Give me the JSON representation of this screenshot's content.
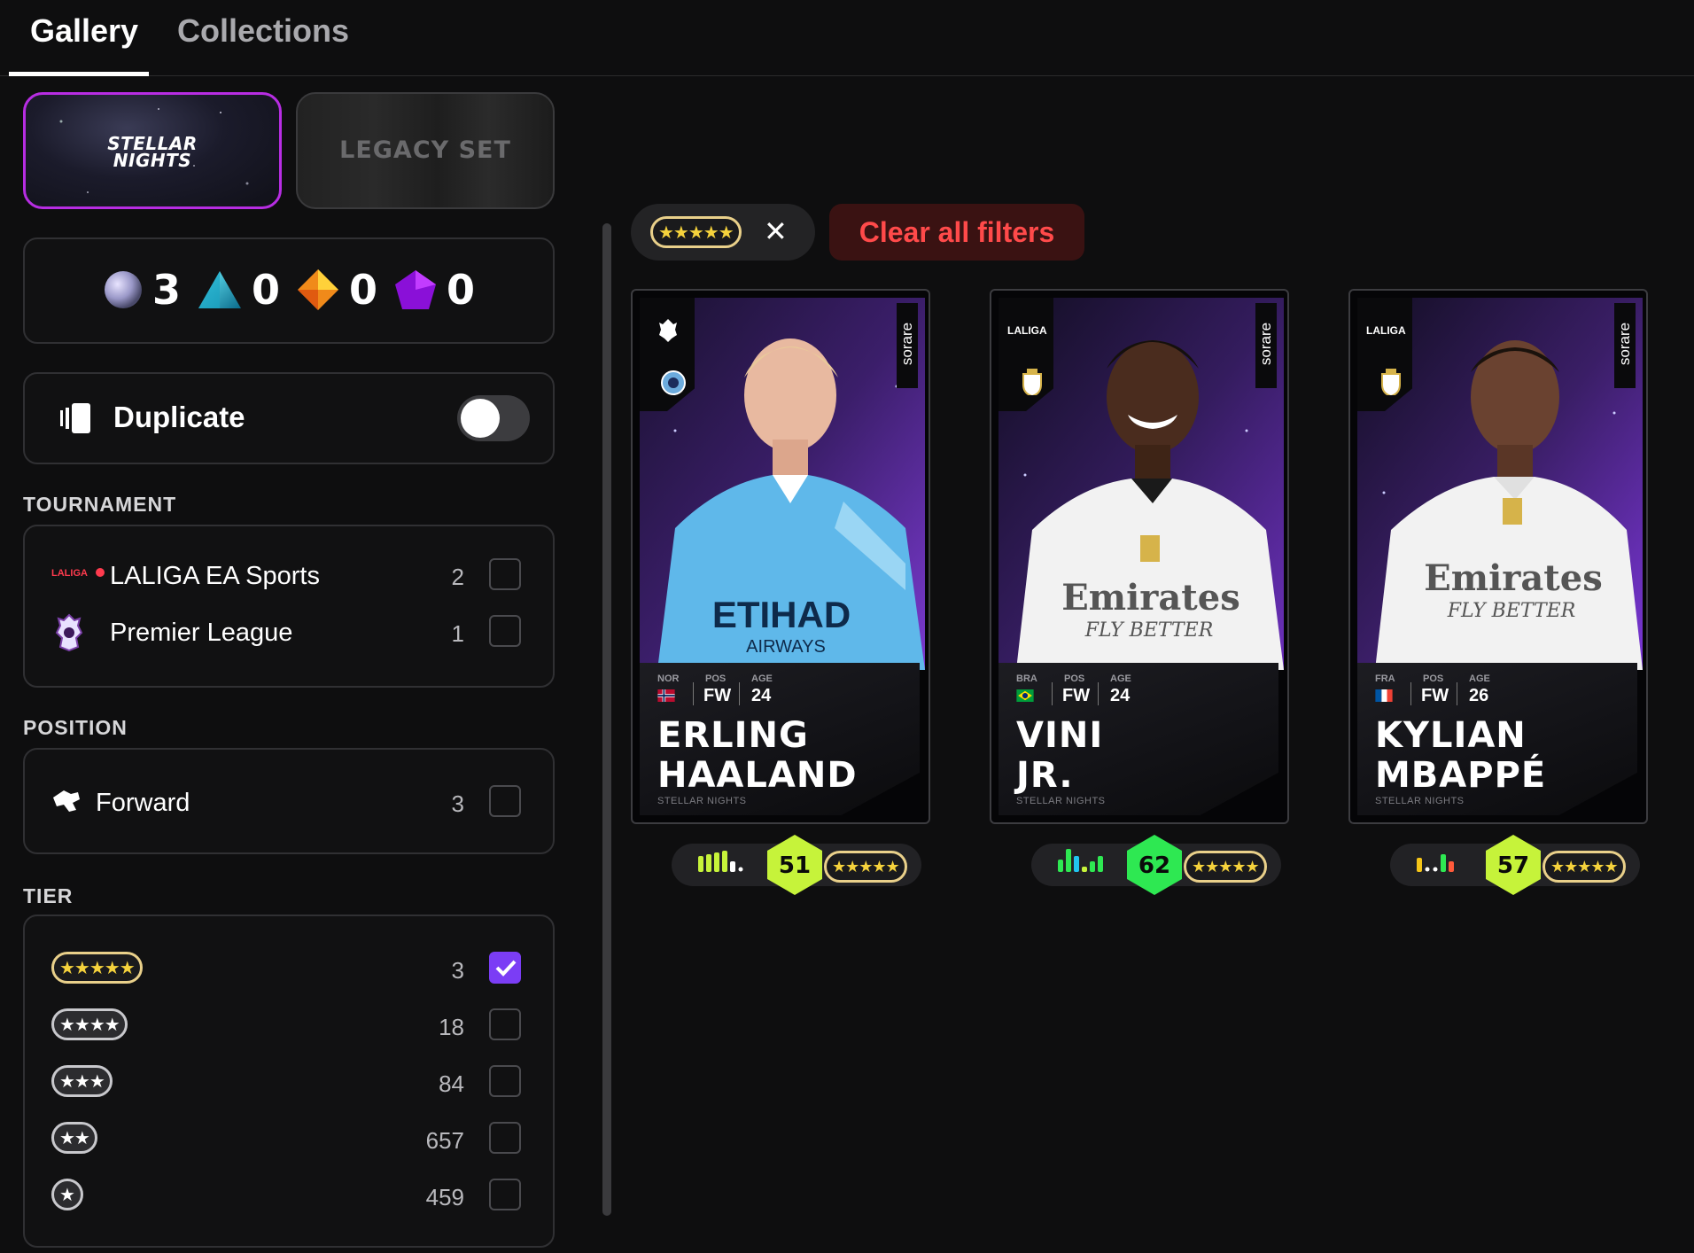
{
  "tabs": [
    {
      "label": "Gallery"
    },
    {
      "label": "Collections"
    }
  ],
  "sets": {
    "stellar_line1": "STELLAR",
    "stellar_line2": "NIGHTS",
    "legacy": "LEGACY SET"
  },
  "rarity_counts": [
    {
      "icon": "orb-icon",
      "count": "3"
    },
    {
      "icon": "triangle-gem-icon",
      "count": "0"
    },
    {
      "icon": "diamond-gem-icon",
      "count": "0"
    },
    {
      "icon": "pentagon-gem-icon",
      "count": "0"
    }
  ],
  "duplicate": {
    "label": "Duplicate",
    "enabled": false
  },
  "tournament": {
    "title": "TOURNAMENT",
    "items": [
      {
        "logo": "LALIGA",
        "label": "LALIGA EA Sports",
        "count": "2",
        "checked": false
      },
      {
        "label": "Premier League",
        "count": "1",
        "checked": false
      }
    ]
  },
  "position": {
    "title": "POSITION",
    "items": [
      {
        "label": "Forward",
        "count": "3",
        "checked": false
      }
    ]
  },
  "tier": {
    "title": "TIER",
    "items": [
      {
        "stars": 5,
        "count": "3",
        "checked": true
      },
      {
        "stars": 4,
        "count": "18",
        "checked": false
      },
      {
        "stars": 3,
        "count": "84",
        "checked": false
      },
      {
        "stars": 2,
        "count": "657",
        "checked": false
      },
      {
        "stars": 1,
        "count": "459",
        "checked": false
      }
    ]
  },
  "active_filter": {
    "stars": 5,
    "remove": "✕"
  },
  "clear_filters": "Clear all filters",
  "cards": [
    {
      "brand": "sorare",
      "league": "",
      "nat": "NOR",
      "pos_label": "POS",
      "pos": "FW",
      "age_label": "AGE",
      "age": "24",
      "name_line1": "ERLING",
      "name_line2": "HAALAND",
      "set": "STELLAR NIGHTS",
      "score": "51",
      "score_color": "#c6f33a",
      "jersey": "#5fb8ea"
    },
    {
      "brand": "sorare",
      "league": "LALIGA",
      "nat": "BRA",
      "pos_label": "POS",
      "pos": "FW",
      "age_label": "AGE",
      "age": "24",
      "name_line1": "VINI",
      "name_line2": "JR.",
      "set": "STELLAR NIGHTS",
      "score": "62",
      "score_color": "#2ee852",
      "jersey": "#f2f2f2"
    },
    {
      "brand": "sorare",
      "league": "LALIGA",
      "nat": "FRA",
      "pos_label": "POS",
      "pos": "FW",
      "age_label": "AGE",
      "age": "26",
      "name_line1": "KYLIAN",
      "name_line2": "MBAPPÉ",
      "set": "STELLAR NIGHTS",
      "score": "57",
      "score_color": "#c6f33a",
      "jersey": "#f2f2f2"
    }
  ],
  "colors": {
    "accent_purple": "#7b3df5",
    "set_border": "#b72de3",
    "clear_red": "#ff4a4a",
    "star_gold": "#f5d23c"
  }
}
